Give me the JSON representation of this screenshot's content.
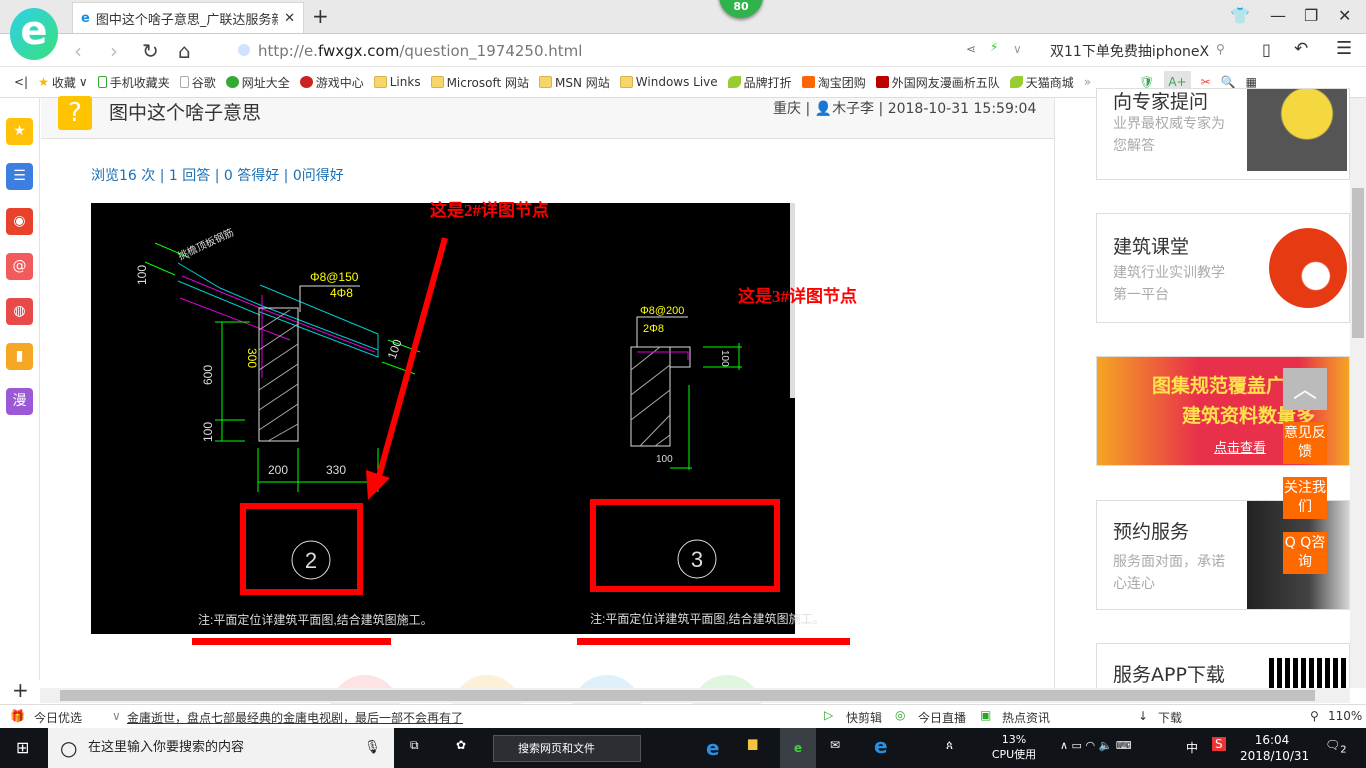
{
  "browser": {
    "tab_title": "图中这个啥子意思_广联达服务新",
    "badge": "80",
    "url_prefix": "http://e.",
    "url_domain": "fwxgx.com",
    "url_path": "/question_1974250.html",
    "promo_search": "双11下单免费抽iphoneX",
    "bookmarks": [
      "收藏",
      "手机收藏夹",
      "谷歌",
      "网址大全",
      "游戏中心",
      "Links",
      "Microsoft 网站",
      "MSN 网站",
      "Windows Live",
      "品牌打折",
      "淘宝团购",
      "外国网友漫画析五队",
      "天猫商城"
    ]
  },
  "sidebar": {
    "items": [
      {
        "icon": "star-icon",
        "color": "#ffb300"
      },
      {
        "icon": "news-icon",
        "color": "#3d7fe0"
      },
      {
        "icon": "weibo-icon",
        "color": "#e8412c"
      },
      {
        "icon": "mail-icon",
        "color": "#f04848"
      },
      {
        "icon": "game-icon",
        "color": "#e84a4a"
      },
      {
        "icon": "book-icon",
        "color": "#f5a623"
      },
      {
        "icon": "comic-icon",
        "label": "漫",
        "color": "#9b59d6"
      }
    ],
    "add": "+"
  },
  "question": {
    "title": "图中这个啥子意思",
    "location": "重庆",
    "user": "木子李",
    "datetime": "2018-10-31 15:59:04",
    "stats": "浏览16 次 | 1 回答 | 0 答得好 | 0问得好"
  },
  "drawing": {
    "annotation_2": "这是2#详图节点",
    "annotation_3": "这是3#详图节点",
    "label_roof": "挑檐顶板钢筋",
    "rebar_2a": "Φ8@150",
    "rebar_2b": "4Φ8",
    "dim_100a": "100",
    "dim_300": "300",
    "dim_600": "600",
    "dim_100b": "100",
    "dim_100c": "100",
    "dim_200": "200",
    "dim_330": "330",
    "rebar_3a": "Φ8@200",
    "rebar_3b": "2Φ8",
    "dim_3a": "100",
    "dim_3b": "100",
    "node_2": "2",
    "node_3": "3",
    "note": "注:平面定位详建筑平面图,结合建筑图施工。"
  },
  "right": {
    "cards": [
      {
        "title": "向专家提问",
        "desc": "业界最权威专家为您解答"
      },
      {
        "title": "建筑课堂",
        "desc": "建筑行业实训教学第一平台"
      },
      {
        "banner_line1": "图集规范覆盖广",
        "banner_line2": "建筑资料数量多",
        "banner_link": "点击查看"
      },
      {
        "title": "预约服务",
        "desc": "服务面对面，承诺心连心"
      },
      {
        "title": "服务APP下载"
      }
    ],
    "float": [
      "意见反馈",
      "关注我们",
      "Q Q咨询"
    ]
  },
  "statusbar": {
    "today": "今日优选",
    "news": "金庸逝世，盘点七部最经典的金庸电视剧，最后一部不会再有了",
    "items": [
      "快剪辑",
      "今日直播",
      "热点资讯",
      "下载"
    ],
    "zoom": "110%"
  },
  "taskbar": {
    "search_placeholder": "在这里输入你要搜索的内容",
    "web_search": "搜索网页和文件",
    "cpu": "13%",
    "cpu_label": "CPU使用",
    "ime": "中",
    "time": "16:04",
    "date": "2018/10/31",
    "notifications": "2"
  }
}
